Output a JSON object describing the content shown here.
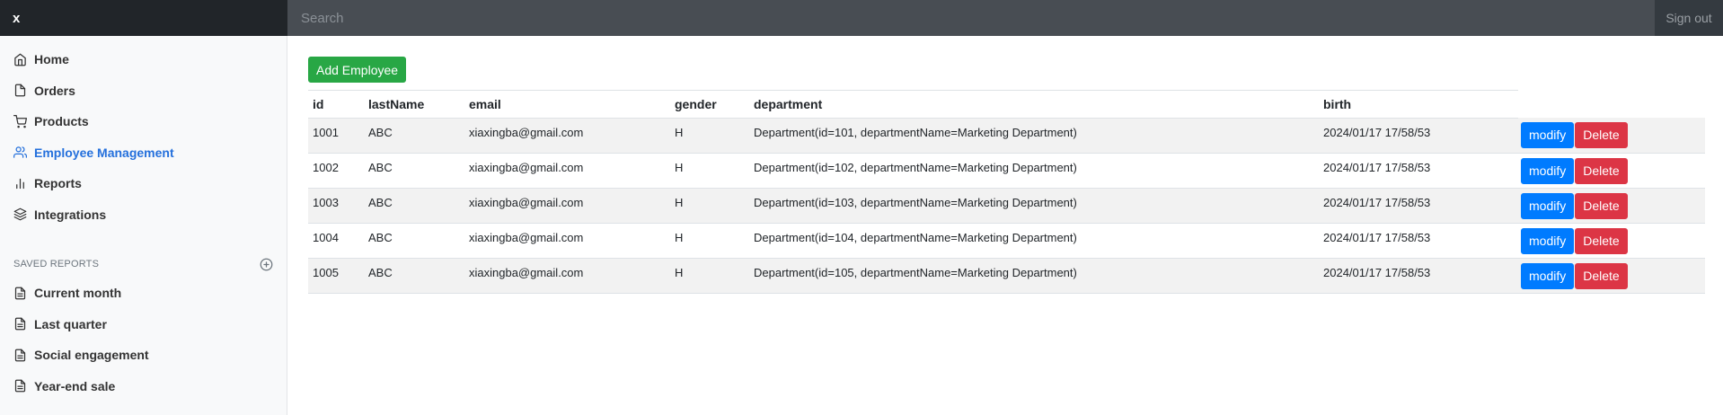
{
  "brand": "x",
  "search": {
    "placeholder": "Search"
  },
  "signout": "Sign out",
  "sidebar": {
    "items": [
      {
        "label": "Home",
        "icon": "home-icon"
      },
      {
        "label": "Orders",
        "icon": "file-icon"
      },
      {
        "label": "Products",
        "icon": "cart-icon"
      },
      {
        "label": "Employee Management",
        "icon": "users-icon",
        "active": true
      },
      {
        "label": "Reports",
        "icon": "bar-chart-icon"
      },
      {
        "label": "Integrations",
        "icon": "layers-icon"
      }
    ],
    "saved_heading": "Saved reports",
    "saved": [
      {
        "label": "Current month"
      },
      {
        "label": "Last quarter"
      },
      {
        "label": "Social engagement"
      },
      {
        "label": "Year-end sale"
      }
    ]
  },
  "main": {
    "add_label": "Add Employee",
    "modify_label": "modify",
    "delete_label": "Delete",
    "columns": [
      "id",
      "lastName",
      "email",
      "gender",
      "department",
      "birth"
    ],
    "rows": [
      [
        "1001",
        "ABC",
        "xiaxingba@gmail.com",
        "H",
        "Department(id=101, departmentName=Marketing Department)",
        "2024/01/17 17/58/53"
      ],
      [
        "1002",
        "ABC",
        "xiaxingba@gmail.com",
        "H",
        "Department(id=102, departmentName=Marketing Department)",
        "2024/01/17 17/58/53"
      ],
      [
        "1003",
        "ABC",
        "xiaxingba@gmail.com",
        "H",
        "Department(id=103, departmentName=Marketing Department)",
        "2024/01/17 17/58/53"
      ],
      [
        "1004",
        "ABC",
        "xiaxingba@gmail.com",
        "H",
        "Department(id=104, departmentName=Marketing Department)",
        "2024/01/17 17/58/53"
      ],
      [
        "1005",
        "ABC",
        "xiaxingba@gmail.com",
        "H",
        "Department(id=105, departmentName=Marketing Department)",
        "2024/01/17 17/58/53"
      ]
    ]
  },
  "colors": {
    "active_nav": "#2470dc",
    "add_button": "#28a745",
    "modify_button": "#007bff",
    "delete_button": "#dc3545",
    "topbar": "#343a40"
  }
}
